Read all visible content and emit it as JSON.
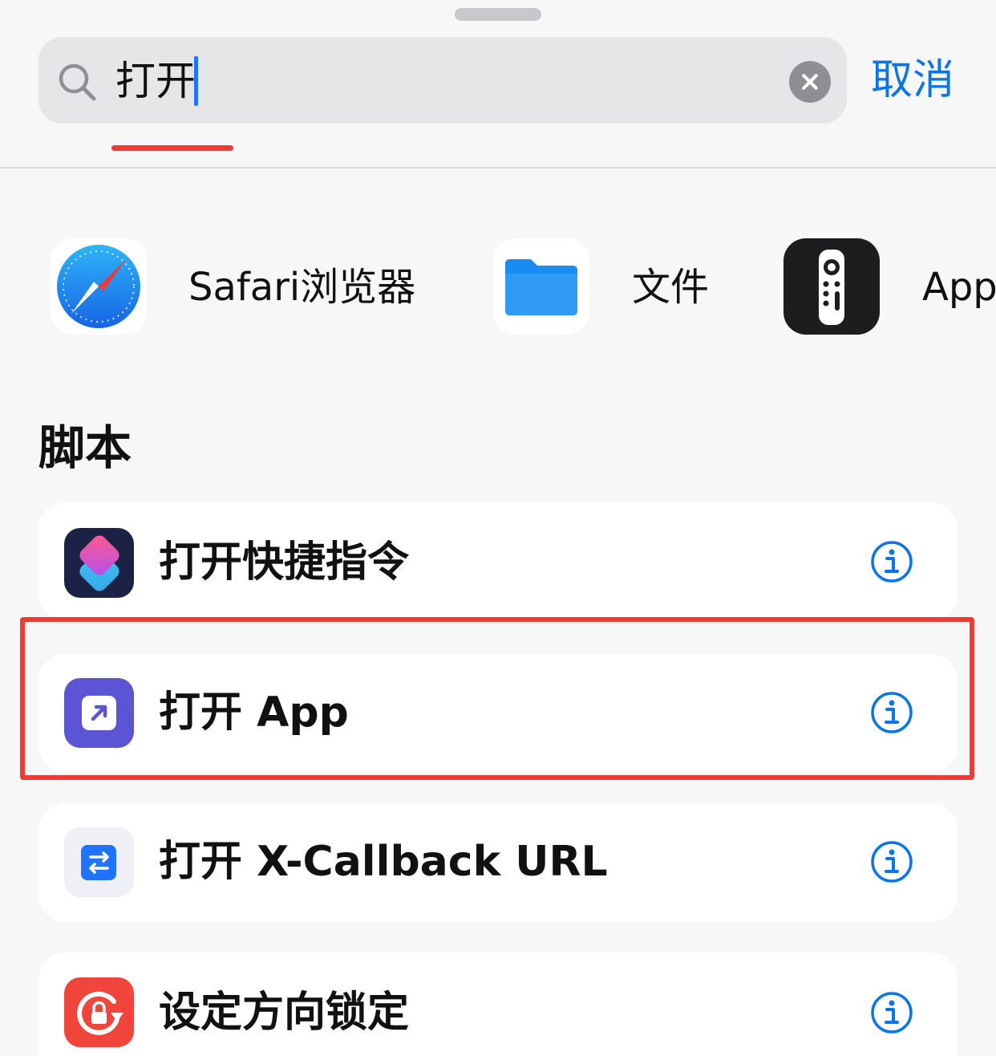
{
  "search": {
    "query": "打开",
    "cancel_label": "取消"
  },
  "apps": [
    {
      "label": "Safari浏览器",
      "icon": "safari-compass-icon"
    },
    {
      "label": "文件",
      "icon": "files-folder-icon"
    },
    {
      "label": "App",
      "icon": "tv-remote-icon"
    }
  ],
  "section": {
    "title": "脚本"
  },
  "actions": [
    {
      "label": "打开快捷指令",
      "icon": "shortcuts-icon"
    },
    {
      "label": "打开 App",
      "icon": "open-app-icon"
    },
    {
      "label": "打开 X-Callback URL",
      "icon": "x-callback-icon"
    },
    {
      "label": "设定方向锁定",
      "icon": "orientation-lock-icon"
    }
  ],
  "colors": {
    "accent": "#0a74ea",
    "annotation": "#f03a33",
    "shortcuts_bg": "#1c2146",
    "open_app_bg": "#5b55d6",
    "x_callback_bg": "#1f74ff",
    "orientation_lock_bg": "#f0453a",
    "safari_blue": "#1a8cf0"
  }
}
